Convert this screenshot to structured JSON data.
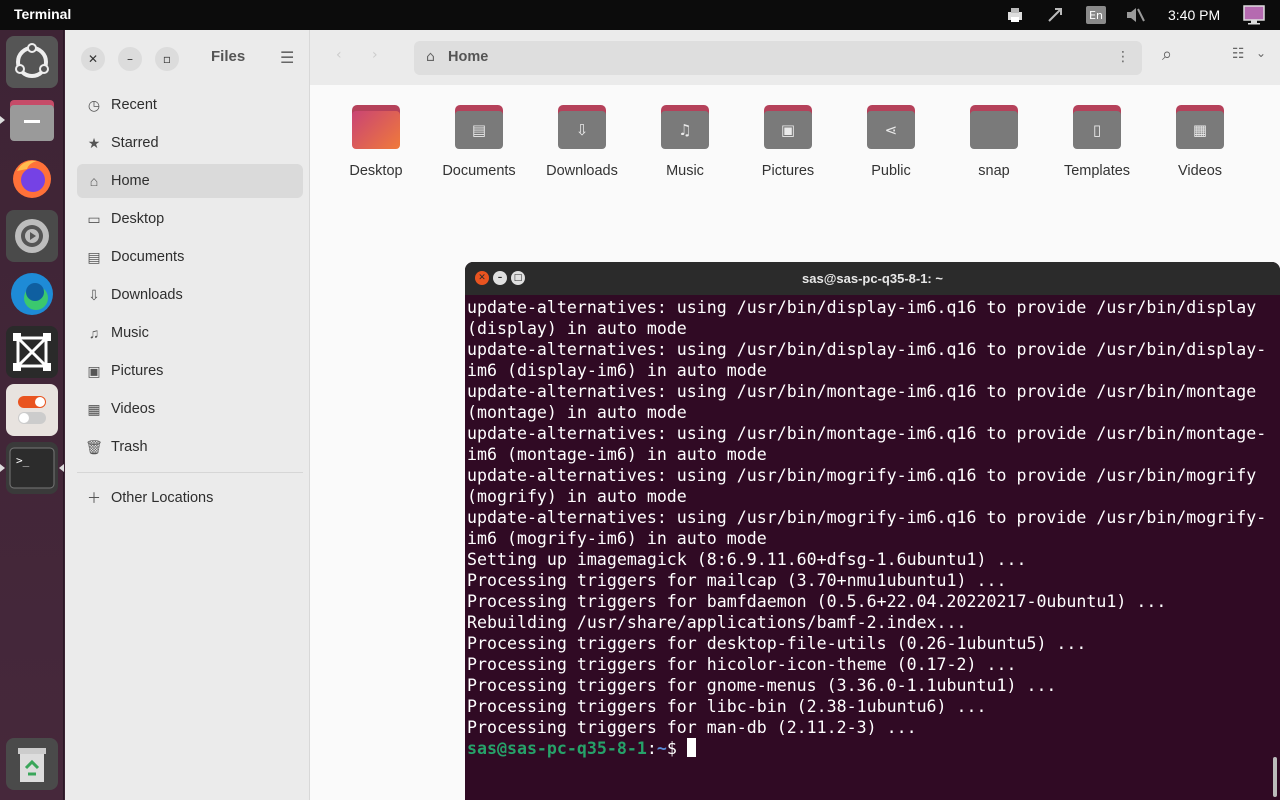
{
  "topbar": {
    "app_name": "Terminal",
    "input_source": "En",
    "clock": "3:40 PM"
  },
  "dock": {
    "items": [
      {
        "name": "ubuntu-logo-icon"
      },
      {
        "name": "files-app-icon"
      },
      {
        "name": "firefox-icon"
      },
      {
        "name": "settings-icon"
      },
      {
        "name": "edge-icon"
      },
      {
        "name": "system-app-icon"
      },
      {
        "name": "tweaks-icon"
      },
      {
        "name": "terminal-app-icon"
      },
      {
        "name": "trash-icon"
      }
    ]
  },
  "files": {
    "title": "Files",
    "path": "Home",
    "sidebar": [
      {
        "label": "Recent",
        "icon": "clock-icon"
      },
      {
        "label": "Starred",
        "icon": "star-icon"
      },
      {
        "label": "Home",
        "icon": "home-icon"
      },
      {
        "label": "Desktop",
        "icon": "desktop-icon"
      },
      {
        "label": "Documents",
        "icon": "document-icon"
      },
      {
        "label": "Downloads",
        "icon": "download-icon"
      },
      {
        "label": "Music",
        "icon": "music-icon"
      },
      {
        "label": "Pictures",
        "icon": "picture-icon"
      },
      {
        "label": "Videos",
        "icon": "video-icon"
      },
      {
        "label": "Trash",
        "icon": "trash-icon"
      },
      {
        "label": "Other Locations",
        "icon": "plus-icon"
      }
    ],
    "folders": [
      {
        "label": "Desktop"
      },
      {
        "label": "Documents"
      },
      {
        "label": "Downloads"
      },
      {
        "label": "Music"
      },
      {
        "label": "Pictures"
      },
      {
        "label": "Public"
      },
      {
        "label": "snap"
      },
      {
        "label": "Templates"
      },
      {
        "label": "Videos"
      }
    ]
  },
  "terminal": {
    "title": "sas@sas-pc-q35-8-1: ~",
    "lines": [
      "update-alternatives: using /usr/bin/display-im6.q16 to provide /usr/bin/display",
      "(display) in auto mode",
      "update-alternatives: using /usr/bin/display-im6.q16 to provide /usr/bin/display-",
      "im6 (display-im6) in auto mode",
      "update-alternatives: using /usr/bin/montage-im6.q16 to provide /usr/bin/montage",
      "(montage) in auto mode",
      "update-alternatives: using /usr/bin/montage-im6.q16 to provide /usr/bin/montage-",
      "im6 (montage-im6) in auto mode",
      "update-alternatives: using /usr/bin/mogrify-im6.q16 to provide /usr/bin/mogrify",
      "(mogrify) in auto mode",
      "update-alternatives: using /usr/bin/mogrify-im6.q16 to provide /usr/bin/mogrify-",
      "im6 (mogrify-im6) in auto mode",
      "Setting up imagemagick (8:6.9.11.60+dfsg-1.6ubuntu1) ...",
      "Processing triggers for mailcap (3.70+nmu1ubuntu1) ...",
      "Processing triggers for bamfdaemon (0.5.6+22.04.20220217-0ubuntu1) ...",
      "Rebuilding /usr/share/applications/bamf-2.index...",
      "Processing triggers for desktop-file-utils (0.26-1ubuntu5) ...",
      "Processing triggers for hicolor-icon-theme (0.17-2) ...",
      "Processing triggers for gnome-menus (3.36.0-1.1ubuntu1) ...",
      "Processing triggers for libc-bin (2.38-1ubuntu6) ...",
      "Processing triggers for man-db (2.11.2-3) ..."
    ],
    "prompt_user": "sas@sas-pc-q35-8-1",
    "prompt_sep": ":",
    "prompt_path": "~",
    "prompt_symbol": "$ "
  }
}
